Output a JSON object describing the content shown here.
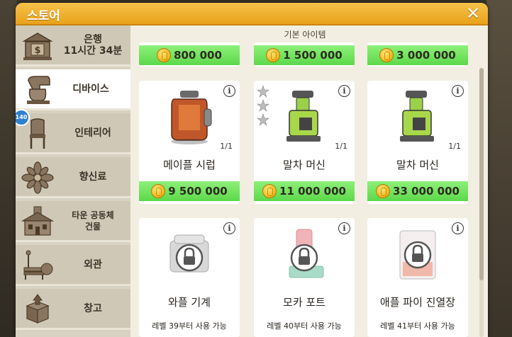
{
  "window": {
    "title": "스토어",
    "close_icon": "close-icon"
  },
  "sidebar": {
    "badge": "140",
    "items": [
      {
        "label": "은행\n11시간 34분",
        "icon": "bank-icon",
        "active": false
      },
      {
        "label": "디바이스",
        "icon": "mixer-icon",
        "active": true
      },
      {
        "label": "인테리어",
        "icon": "chair-icon",
        "active": false
      },
      {
        "label": "향신료",
        "icon": "flower-icon",
        "active": false
      },
      {
        "label": "타운 공동체\n건물",
        "icon": "building-icon",
        "active": false
      },
      {
        "label": "외관",
        "icon": "bench-icon",
        "active": false
      },
      {
        "label": "창고",
        "icon": "box-icon",
        "active": false
      }
    ]
  },
  "content": {
    "section_label": "기본 아이템",
    "top_prices": [
      "800 000",
      "1 500 000",
      "3 000 000"
    ],
    "row1": [
      {
        "name": "메이플 시럽",
        "count": "1/1",
        "price": "9 500 000",
        "icon": "maple-syrup-icon"
      },
      {
        "name": "말차 머신",
        "count": "1/1",
        "price": "11 000 000",
        "icon": "matcha-machine-icon"
      },
      {
        "name": "말차 머신",
        "count": "1/1",
        "price": "33 000 000",
        "icon": "matcha-machine-icon"
      }
    ],
    "row2": [
      {
        "name": "와플 기계",
        "requirement": "레벨 39부터 사용 가능",
        "icon": "waffle-machine-icon"
      },
      {
        "name": "모카 포트",
        "requirement": "레벨 40부터 사용 가능",
        "icon": "moka-pot-icon"
      },
      {
        "name": "애플 파이 진열장",
        "requirement": "레벨 41부터 사용 가능",
        "icon": "pie-display-icon"
      }
    ]
  },
  "colors": {
    "title_bar": "#e8a21a",
    "price_bar": "#5cd84a",
    "active_tab": "#ffffff"
  }
}
